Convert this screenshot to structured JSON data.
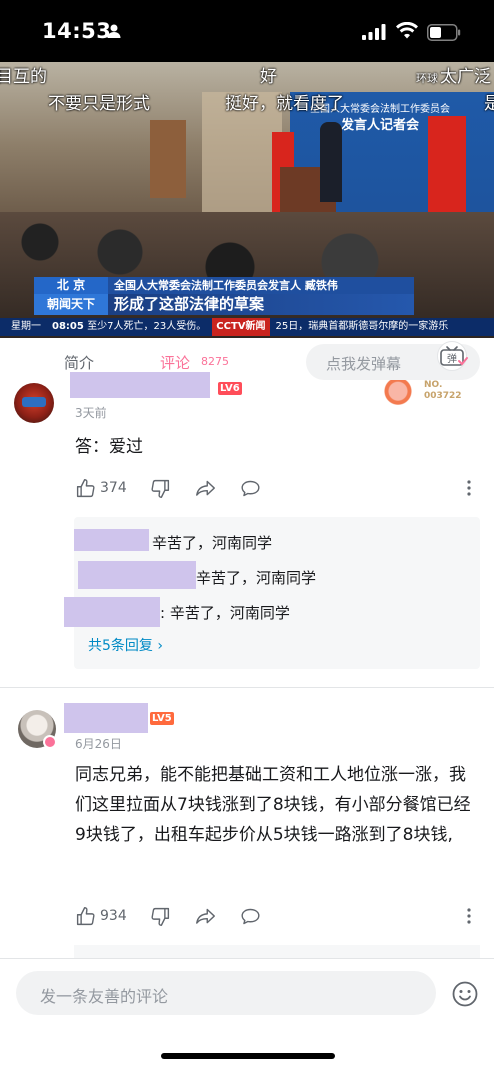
{
  "status_bar": {
    "time": "14:53"
  },
  "video": {
    "danmaku": [
      "目互的",
      "好",
      "太广泛",
      "不要只是形式",
      "挺好，就看度了",
      "是"
    ],
    "location": "北 京",
    "subtitle": "全国人大常委会法制工作委员会发言人 臧铁伟",
    "program": "朝闻天下",
    "headline": "形成了这部法律的草案",
    "ticker_day": "星期一",
    "ticker_time": "08:05",
    "ticker_text_1": "至少7人死亡，23人受伤。",
    "ticker_channel": "CCTV新闻",
    "ticker_text_2": "25日，瑞典首都斯德哥尔摩的一家游乐",
    "board_line1": "全国人大常委会法制工作委员会",
    "board_line2": "发言人记者会",
    "watermark": "环球"
  },
  "tabs": {
    "intro": "简介",
    "comment": "评论",
    "comment_count": "8275",
    "danmaku_placeholder": "点我发弹幕",
    "danmaku_button": "弹"
  },
  "comments": [
    {
      "level": "LV6",
      "fan_no_label": "NO.",
      "fan_no": "003722",
      "time": "3天前",
      "text": "答：爱过",
      "likes": "374",
      "replies": [
        {
          "text": "辛苦了，河南同学"
        },
        {
          "text": "辛苦了，河南同学"
        },
        {
          "text": ": 辛苦了，河南同学"
        }
      ],
      "more_replies": "共5条回复"
    },
    {
      "level": "LV5",
      "time": "6月26日",
      "text": "同志兄弟，能不能把基础工资和工人地位涨一涨，我们这里拉面从7块钱涨到了8块钱，有小部分餐馆已经9块钱了，出租车起步价从5块钱一路涨到了8块钱,",
      "likes": "934"
    }
  ],
  "bottom_bar": {
    "placeholder": "发一条友善的评论"
  },
  "colors": {
    "accent": "#fb7299",
    "link": "#008ac5",
    "mask": "#cfc4ec"
  }
}
